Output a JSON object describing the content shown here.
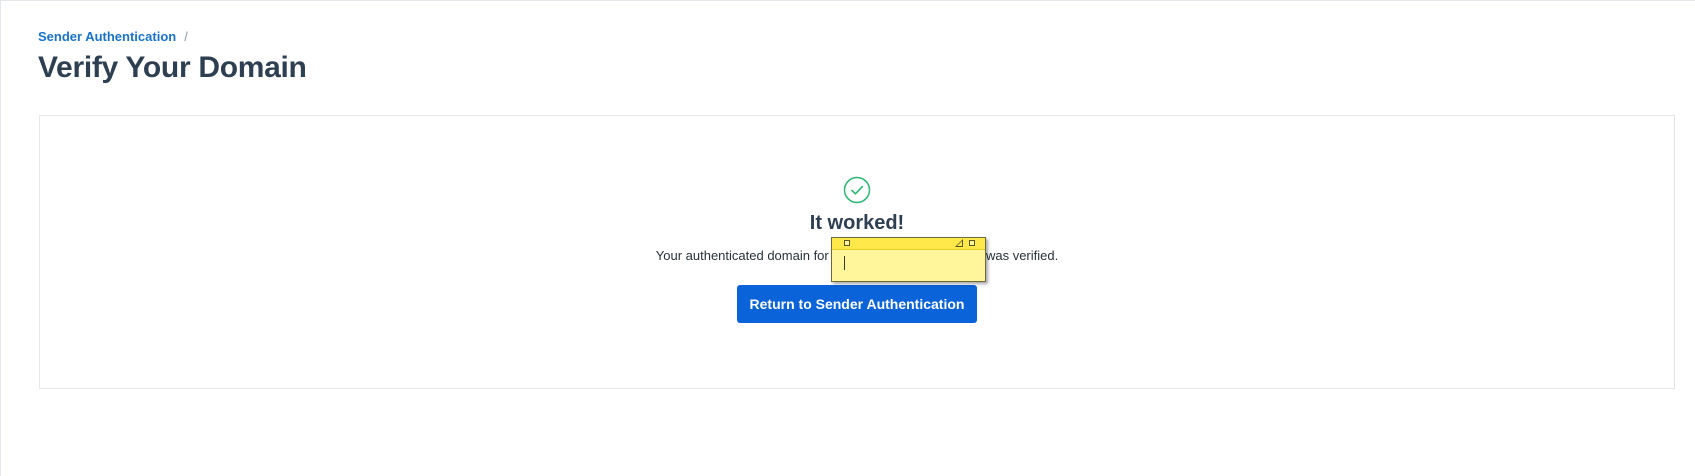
{
  "breadcrumb": {
    "parent_label": "Sender Authentication",
    "separator": "/"
  },
  "page": {
    "title": "Verify Your Domain"
  },
  "result": {
    "icon": "check-circle-icon",
    "heading": "It worked!",
    "message_before": "Your authenticated domain for ",
    "message_after": " was verified.",
    "button_label": "Return to Sender Authentication"
  },
  "sticky_note": {
    "text": ""
  },
  "colors": {
    "link": "#1a73c9",
    "primary": "#0a63d9",
    "success": "#2bb673",
    "title": "#2e3f52",
    "note": "#fff59a"
  }
}
